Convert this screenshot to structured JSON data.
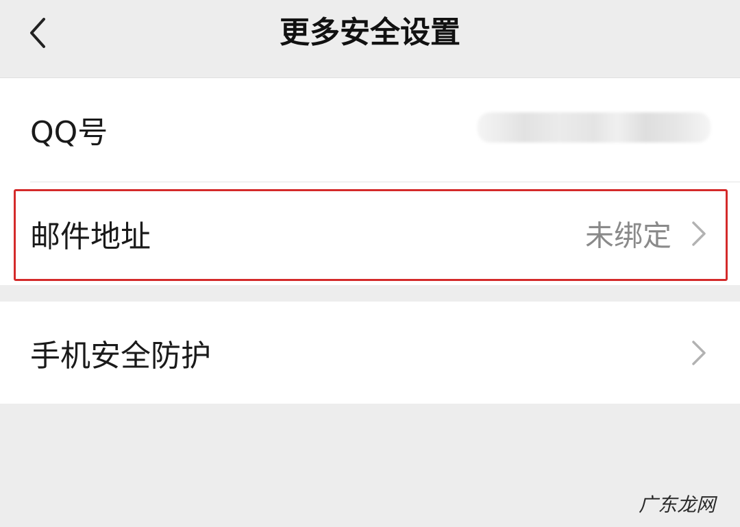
{
  "nav": {
    "title": "更多安全设置",
    "back_icon": "chevron-left-icon"
  },
  "rows": [
    {
      "label": "QQ号",
      "value": "",
      "value_blurred": true,
      "has_chevron": false
    },
    {
      "label": "邮件地址",
      "value": "未绑定",
      "has_chevron": true,
      "highlighted": true
    },
    {
      "label": "手机安全防护",
      "value": "",
      "has_chevron": true
    }
  ],
  "watermark": "广东龙网",
  "colors": {
    "background": "#ededed",
    "section_bg": "#ffffff",
    "highlight_border": "#d42a2a",
    "secondary_text": "#8a8a8a"
  }
}
